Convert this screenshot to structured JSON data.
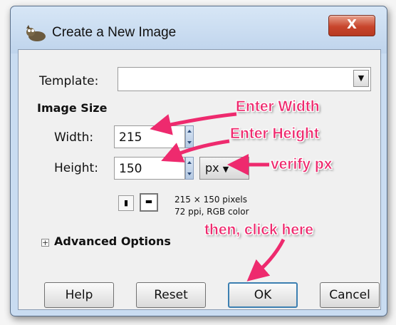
{
  "window": {
    "title": "Create a New Image",
    "close_glyph": "X"
  },
  "template": {
    "label": "Template:",
    "value": ""
  },
  "image_size": {
    "heading": "Image Size",
    "width_label": "Width:",
    "width_value": "215",
    "height_label": "Height:",
    "height_value": "150",
    "unit": "px"
  },
  "info": {
    "dimensions": "215 × 150 pixels",
    "resolution": "72 ppi, RGB color"
  },
  "advanced": {
    "label": "Advanced Options"
  },
  "buttons": {
    "help": "Help",
    "reset": "Reset",
    "ok": "OK",
    "cancel": "Cancel"
  },
  "annotations": {
    "width": "Enter Width",
    "height": "Enter Height",
    "px": "verify px",
    "ok": "then, click here",
    "color": "#ee2a6e"
  },
  "icons": [
    "wilber-icon",
    "portrait-icon",
    "landscape-icon",
    "expand-icon",
    "chevron-down-icon",
    "close-icon"
  ]
}
